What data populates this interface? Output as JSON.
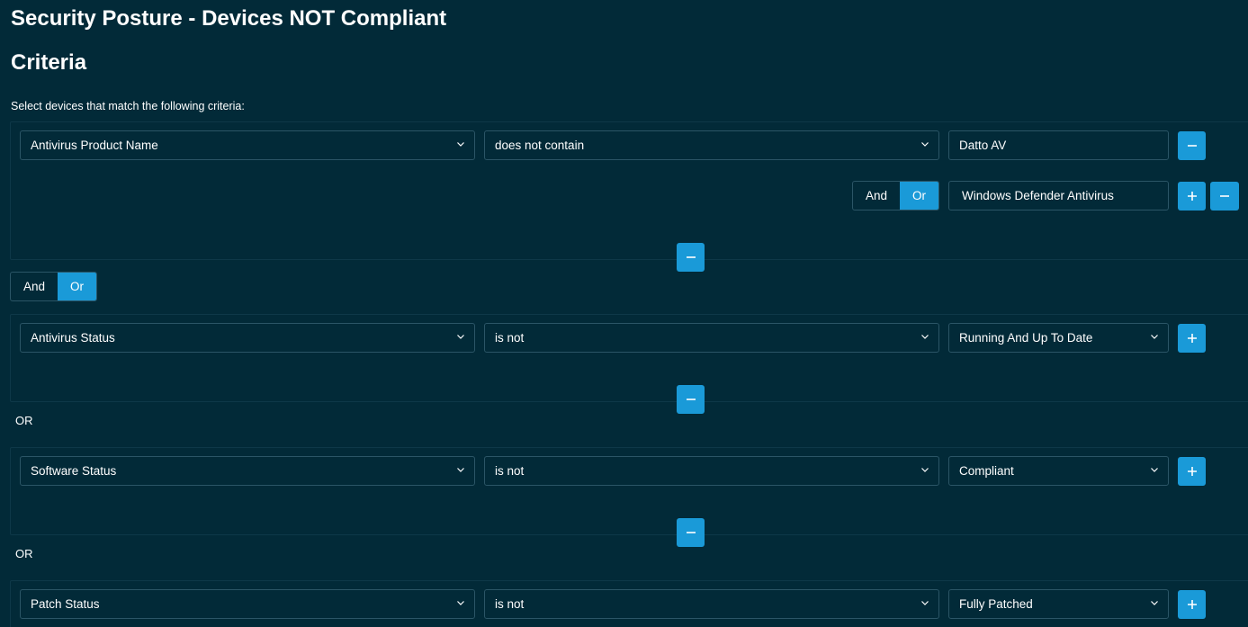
{
  "page": {
    "title": "Security Posture - Devices NOT Compliant",
    "section_title": "Criteria",
    "intro": "Select devices that match the following criteria:"
  },
  "groups": [
    {
      "field": "Antivirus Product Name",
      "operator": "does not contain",
      "values": [
        "Datto AV",
        "Windows Defender Antivirus"
      ],
      "value_join": {
        "and_label": "And",
        "or_label": "Or",
        "selected": "Or"
      }
    },
    {
      "field": "Antivirus Status",
      "operator": "is not",
      "value": "Running And Up To Date"
    },
    {
      "field": "Software Status",
      "operator": "is not",
      "value": "Compliant"
    },
    {
      "field": "Patch Status",
      "operator": "is not",
      "value": "Fully Patched"
    }
  ],
  "group_join": {
    "and_label": "And",
    "or_label": "Or",
    "selected": "Or"
  },
  "or_separator": "OR",
  "icons": {
    "add": "plus-icon",
    "remove": "minus-icon",
    "dropdown": "chevron-down-icon"
  },
  "colors": {
    "background": "#022a38",
    "accent": "#1a9ad8",
    "border": "#2b5566"
  }
}
